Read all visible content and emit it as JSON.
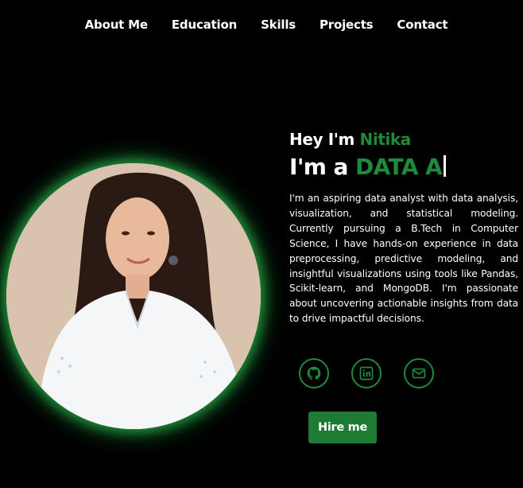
{
  "nav": {
    "items": [
      {
        "label": "About Me"
      },
      {
        "label": "Education"
      },
      {
        "label": "Skills"
      },
      {
        "label": "Projects"
      },
      {
        "label": "Contact"
      }
    ]
  },
  "hero": {
    "greeting_prefix": "Hey I'm ",
    "name": "Nitika",
    "role_prefix": "I'm a ",
    "role_typed": "DATA A",
    "bio": "I'm an aspiring data analyst with data analysis, visualization, and statistical modeling. Currently pursuing a B.Tech in Computer Science, I have hands-on experience in data preprocessing, predictive modeling, and insightful visualizations using tools like Pandas, Scikit-learn, and MongoDB. I'm passionate about uncovering actionable insights from data to drive impactful decisions.",
    "hire_label": "Hire me"
  },
  "socials": [
    {
      "icon": "github-icon"
    },
    {
      "icon": "linkedin-icon"
    },
    {
      "icon": "mail-icon"
    }
  ],
  "colors": {
    "background": "#000000",
    "accent": "#1f8a3b",
    "button": "#1f7a34"
  }
}
